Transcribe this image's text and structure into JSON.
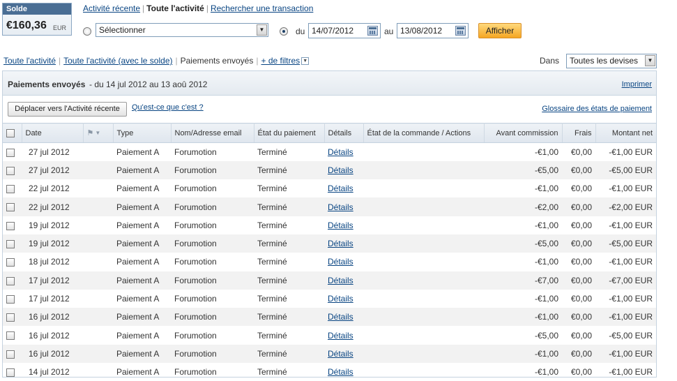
{
  "balance": {
    "label": "Solde",
    "amount": "€160,36",
    "currency": "EUR"
  },
  "top_links": {
    "recent": "Activité récente",
    "all": "Toute l'activité",
    "search": "Rechercher une transaction"
  },
  "filters": {
    "select_value": "Sélectionner",
    "from_label": "du",
    "from_date": "14/07/2012",
    "to_label": "au",
    "to_date": "13/08/2012",
    "show_button": "Afficher"
  },
  "subnav": {
    "all": "Toute l'activité",
    "all_balance": "Toute l'activité (avec le solde)",
    "sent": "Paiements envoyés",
    "more_filters": "+ de filtres",
    "in_label": "Dans",
    "currency_value": "Toutes les devises"
  },
  "panel": {
    "title": "Paiements envoyés",
    "range": "- du 14 jul 2012 au 13 aoû 2012",
    "print": "Imprimer",
    "move_button": "Déplacer vers l'Activité récente",
    "whats_this": "Qu'est-ce que c'est ?",
    "glossary": "Glossaire des états de paiement"
  },
  "table": {
    "columns": [
      "Date",
      "Type",
      "Nom/Adresse email",
      "État du paiement",
      "Détails",
      "État de la commande / Actions",
      "Avant commission",
      "Frais",
      "Montant net"
    ],
    "rows": [
      {
        "date": "27 jul 2012",
        "type": "Paiement A",
        "name": "Forumotion",
        "status": "Terminé",
        "details": "Détails",
        "gross": "-€1,00",
        "fee": "€0,00",
        "net": "-€1,00 EUR"
      },
      {
        "date": "27 jul 2012",
        "type": "Paiement A",
        "name": "Forumotion",
        "status": "Terminé",
        "details": "Détails",
        "gross": "-€5,00",
        "fee": "€0,00",
        "net": "-€5,00 EUR"
      },
      {
        "date": "22 jul 2012",
        "type": "Paiement A",
        "name": "Forumotion",
        "status": "Terminé",
        "details": "Détails",
        "gross": "-€1,00",
        "fee": "€0,00",
        "net": "-€1,00 EUR"
      },
      {
        "date": "22 jul 2012",
        "type": "Paiement A",
        "name": "Forumotion",
        "status": "Terminé",
        "details": "Détails",
        "gross": "-€2,00",
        "fee": "€0,00",
        "net": "-€2,00 EUR"
      },
      {
        "date": "19 jul 2012",
        "type": "Paiement A",
        "name": "Forumotion",
        "status": "Terminé",
        "details": "Détails",
        "gross": "-€1,00",
        "fee": "€0,00",
        "net": "-€1,00 EUR"
      },
      {
        "date": "19 jul 2012",
        "type": "Paiement A",
        "name": "Forumotion",
        "status": "Terminé",
        "details": "Détails",
        "gross": "-€5,00",
        "fee": "€0,00",
        "net": "-€5,00 EUR"
      },
      {
        "date": "18 jul 2012",
        "type": "Paiement A",
        "name": "Forumotion",
        "status": "Terminé",
        "details": "Détails",
        "gross": "-€1,00",
        "fee": "€0,00",
        "net": "-€1,00 EUR"
      },
      {
        "date": "17 jul 2012",
        "type": "Paiement A",
        "name": "Forumotion",
        "status": "Terminé",
        "details": "Détails",
        "gross": "-€7,00",
        "fee": "€0,00",
        "net": "-€7,00 EUR"
      },
      {
        "date": "17 jul 2012",
        "type": "Paiement A",
        "name": "Forumotion",
        "status": "Terminé",
        "details": "Détails",
        "gross": "-€1,00",
        "fee": "€0,00",
        "net": "-€1,00 EUR"
      },
      {
        "date": "16 jul 2012",
        "type": "Paiement A",
        "name": "Forumotion",
        "status": "Terminé",
        "details": "Détails",
        "gross": "-€1,00",
        "fee": "€0,00",
        "net": "-€1,00 EUR"
      },
      {
        "date": "16 jul 2012",
        "type": "Paiement A",
        "name": "Forumotion",
        "status": "Terminé",
        "details": "Détails",
        "gross": "-€5,00",
        "fee": "€0,00",
        "net": "-€5,00 EUR"
      },
      {
        "date": "16 jul 2012",
        "type": "Paiement A",
        "name": "Forumotion",
        "status": "Terminé",
        "details": "Détails",
        "gross": "-€1,00",
        "fee": "€0,00",
        "net": "-€1,00 EUR"
      },
      {
        "date": "14 jul 2012",
        "type": "Paiement A",
        "name": "Forumotion",
        "status": "Terminé",
        "details": "Détails",
        "gross": "-€1,00",
        "fee": "€0,00",
        "net": "-€1,00 EUR"
      }
    ]
  },
  "colors": {
    "link": "#084482",
    "accent_orange": "#f5a623",
    "header_blue": "#4a6e94",
    "row_alt": "#f2f2f2"
  }
}
